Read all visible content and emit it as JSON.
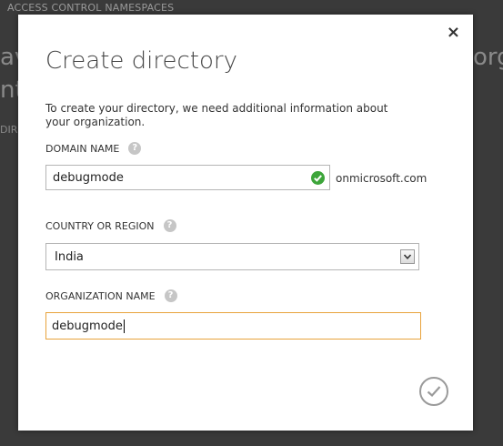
{
  "background": {
    "header_label": "ACCESS CONTROL NAMESPACES",
    "heading_fragment_left_1": "ave",
    "heading_fragment_left_2": "nte",
    "heading_fragment_right_1": "org",
    "sub_fragment_left": "DIR"
  },
  "modal": {
    "close_icon": "×",
    "title": "Create directory",
    "intro": "To create your directory, we need additional information about your organization.",
    "domain": {
      "label": "DOMAIN NAME",
      "value": "debugmode",
      "suffix": "onmicrosoft.com",
      "status_icon": "check-circle-icon",
      "status_color": "#3da53a"
    },
    "country": {
      "label": "COUNTRY OR REGION",
      "selected": "India"
    },
    "organization": {
      "label": "ORGANIZATION NAME",
      "value": "debugmode",
      "focus_color": "#e8a33c"
    },
    "help_glyph": "?",
    "submit_icon": "checkmark-circle-icon"
  }
}
